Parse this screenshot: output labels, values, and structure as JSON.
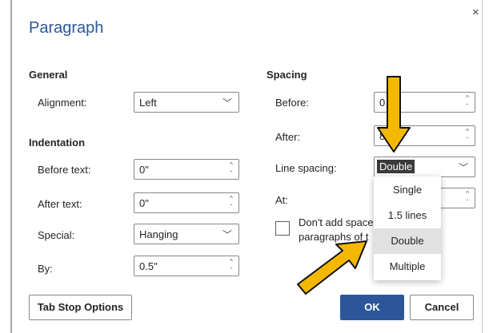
{
  "dialog": {
    "title": "Paragraph",
    "close_glyph": "×"
  },
  "general": {
    "heading": "General",
    "alignment_label": "Alignment:",
    "alignment_value": "Left"
  },
  "indentation": {
    "heading": "Indentation",
    "before_label": "Before text:",
    "before_value": "0\"",
    "after_label": "After text:",
    "after_value": "0\"",
    "special_label": "Special:",
    "special_value": "Hanging",
    "by_label": "By:",
    "by_value": "0.5\""
  },
  "spacing": {
    "heading": "Spacing",
    "before_label": "Before:",
    "before_value": "0",
    "after_label": "After:",
    "after_value": "8",
    "line_spacing_label": "Line spacing:",
    "line_spacing_value": "Double",
    "at_label": "At:",
    "at_value": "",
    "dont_add_text_line1": "Don't add space",
    "dont_add_text_line2": "paragraphs of t",
    "line_spacing_options": [
      "Single",
      "1.5 lines",
      "Double",
      "Multiple"
    ]
  },
  "buttons": {
    "tab_stop": "Tab Stop Options",
    "ok": "OK",
    "cancel": "Cancel"
  },
  "colors": {
    "accent": "#2b579a",
    "annotation_arrow": "#f5b800"
  }
}
